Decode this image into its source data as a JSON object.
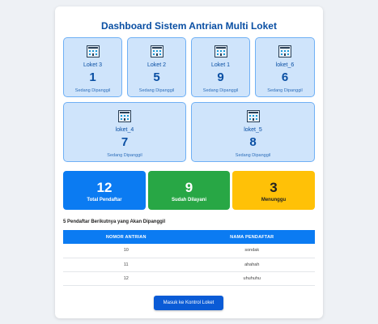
{
  "page": {
    "title": "Dashboard Sistem Antrian Multi Loket"
  },
  "lokets": [
    {
      "name": "Loket 3",
      "number": "1",
      "status": "Sedang Dipanggil",
      "icon": "building-icon"
    },
    {
      "name": "Loket 2",
      "number": "5",
      "status": "Sedang Dipanggil",
      "icon": "building-icon"
    },
    {
      "name": "Loket 1",
      "number": "9",
      "status": "Sedang Dipanggil",
      "icon": "building-icon"
    },
    {
      "name": "loket_6",
      "number": "6",
      "status": "Sedang Dipanggil",
      "icon": "building-icon"
    },
    {
      "name": "loket_4",
      "number": "7",
      "status": "Sedang Dipanggil",
      "icon": "building-icon"
    },
    {
      "name": "loket_5",
      "number": "8",
      "status": "Sedang Dipanggil",
      "icon": "building-icon"
    }
  ],
  "stats": {
    "total": {
      "value": "12",
      "label": "Total Pendaftar",
      "color": "#0b7bf2"
    },
    "served": {
      "value": "9",
      "label": "Sudah Dilayani",
      "color": "#28a745"
    },
    "waiting": {
      "value": "3",
      "label": "Menunggu",
      "color": "#ffc107"
    }
  },
  "next_list": {
    "title": "5 Pendaftar Berikutnya yang Akan Dipanggil",
    "columns": [
      "NOMOR ANTRIAN",
      "NAMA PENDAFTAR"
    ],
    "rows": [
      {
        "nomor": "10",
        "nama": "sondak"
      },
      {
        "nomor": "11",
        "nama": "ahahah"
      },
      {
        "nomor": "12",
        "nama": "uhuhuhu"
      }
    ]
  },
  "actions": {
    "control_button": "Masuk ke Kontrol Loket"
  }
}
